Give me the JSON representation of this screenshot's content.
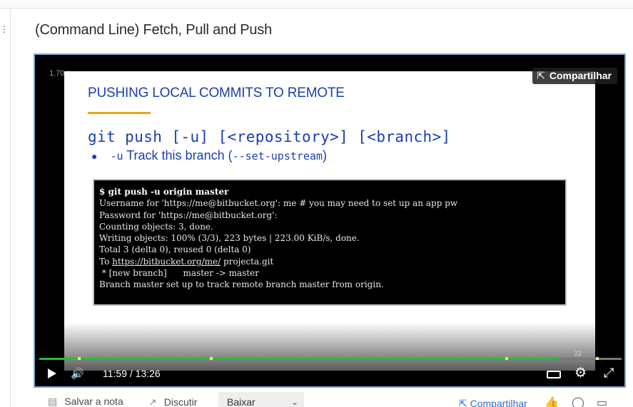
{
  "lesson": {
    "title": "(Command Line) Fetch, Pull and Push"
  },
  "player": {
    "speed": "1.70",
    "share_label": "Compartilhar",
    "current_time": "11:59",
    "time_separator": "/",
    "duration": "13:26",
    "progress_fraction": 0.892,
    "cue_points_fraction": [
      0.069,
      0.295,
      0.803,
      0.958
    ],
    "cue_label": "22"
  },
  "slide": {
    "heading": "PUSHING LOCAL COMMITS TO REMOTE",
    "command": "git push [-u] [<repository>] [<branch>]",
    "bullet_flag": "-u",
    "bullet_text": " Track this branch (",
    "bullet_option": "--set-upstream",
    "bullet_close": ")",
    "terminal": {
      "prompt_line": "$ git push -u origin master",
      "lines": [
        "Username for 'https://me@bitbucket.org': me # you may need to set up an app pw",
        "Password for 'https://me@bitbucket.org':",
        "Counting objects: 3, done.",
        "Writing objects: 100% (3/3), 223 bytes | 223.00 KiB/s, done.",
        "Total 3 (delta 0), reused 0 (delta 0)"
      ],
      "to_prefix": "To ",
      "to_link": "https://bitbucket.org/me/",
      "to_suffix": " projecta.git",
      "branch_line": " * [new branch]      master -> master",
      "final_line": "Branch master set up to track remote branch master from origin."
    }
  },
  "bottom": {
    "save_note": "Salvar a nota",
    "discuss": "Discutir",
    "download": "Baixar",
    "share": "Compartilhar"
  },
  "colors": {
    "accent_blue": "#1a3fb0",
    "progress_green": "#1ebe3a",
    "rule_orange": "#f0a21a",
    "link_blue": "#2b6fd6"
  }
}
